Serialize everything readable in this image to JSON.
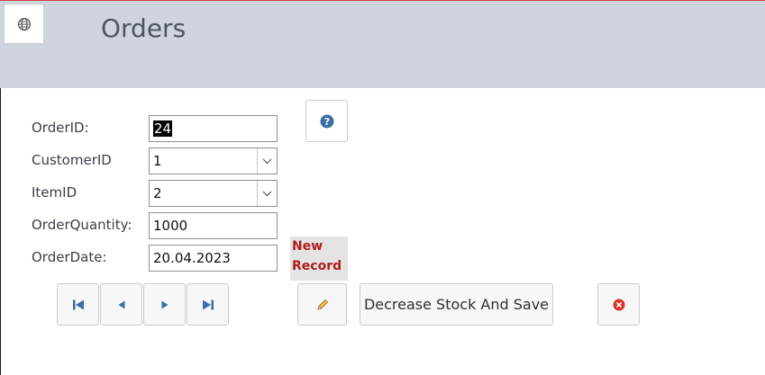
{
  "header": {
    "title": "Orders",
    "icon": "globe-icon"
  },
  "form": {
    "fields": [
      {
        "label": "OrderID:",
        "value": "24"
      },
      {
        "label": "CustomerID",
        "value": "1"
      },
      {
        "label": "ItemID",
        "value": "2"
      },
      {
        "label": "OrderQuantity:",
        "value": "1000"
      },
      {
        "label": "OrderDate:",
        "value": "20.04.2023"
      }
    ],
    "status": "New\nRecord"
  },
  "buttons": {
    "decrease_label": "Decrease Stock And Save"
  },
  "colors": {
    "header_bg": "#d0d4dc",
    "status_text": "#b01c1c",
    "help_icon": "#3b6ea5",
    "close_icon": "#d9342b"
  }
}
